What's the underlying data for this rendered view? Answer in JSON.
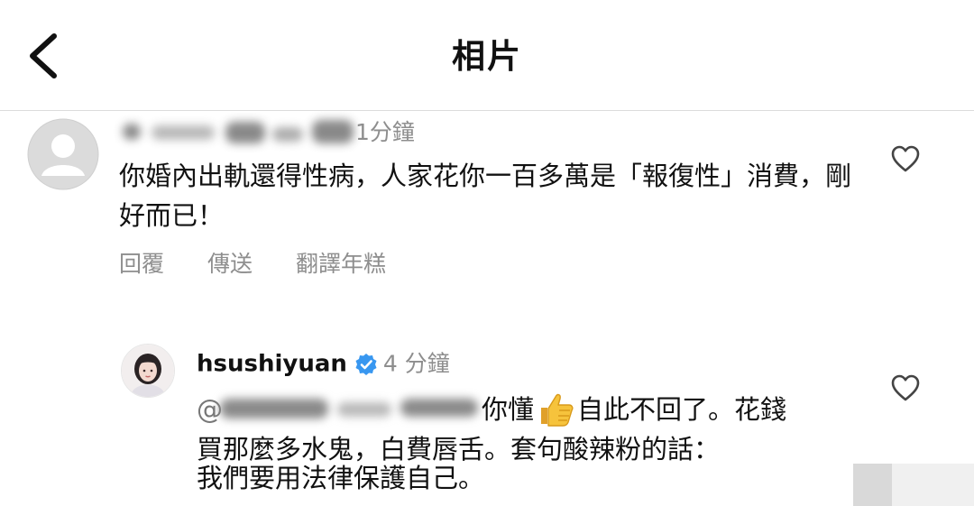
{
  "header": {
    "title": "相片"
  },
  "comments": [
    {
      "username_redacted": true,
      "time": "1分鐘",
      "text": "你婚內出軌還得性病，人家花你一百多萬是「報復性」消費，剛好而已！",
      "actions": {
        "reply": "回覆",
        "send": "傳送",
        "translate": "翻譯年糕"
      }
    },
    {
      "username": "hsushiyuan",
      "verified": true,
      "time": "4 分鐘",
      "mention_prefix": "@",
      "text_line1": "你懂",
      "text_line1_after_emoji": "自此不回了。花錢",
      "emoji": "thumbs-up",
      "text_line2": "買那麼多水鬼，白費唇舌。套句酸辣粉的話：",
      "text_line3": "我們要用法律保護自己。"
    }
  ],
  "colors": {
    "text": "#111111",
    "secondary_text": "#8e8e8e",
    "divider": "#dcdcdc",
    "verified_blue": "#3897f0"
  }
}
